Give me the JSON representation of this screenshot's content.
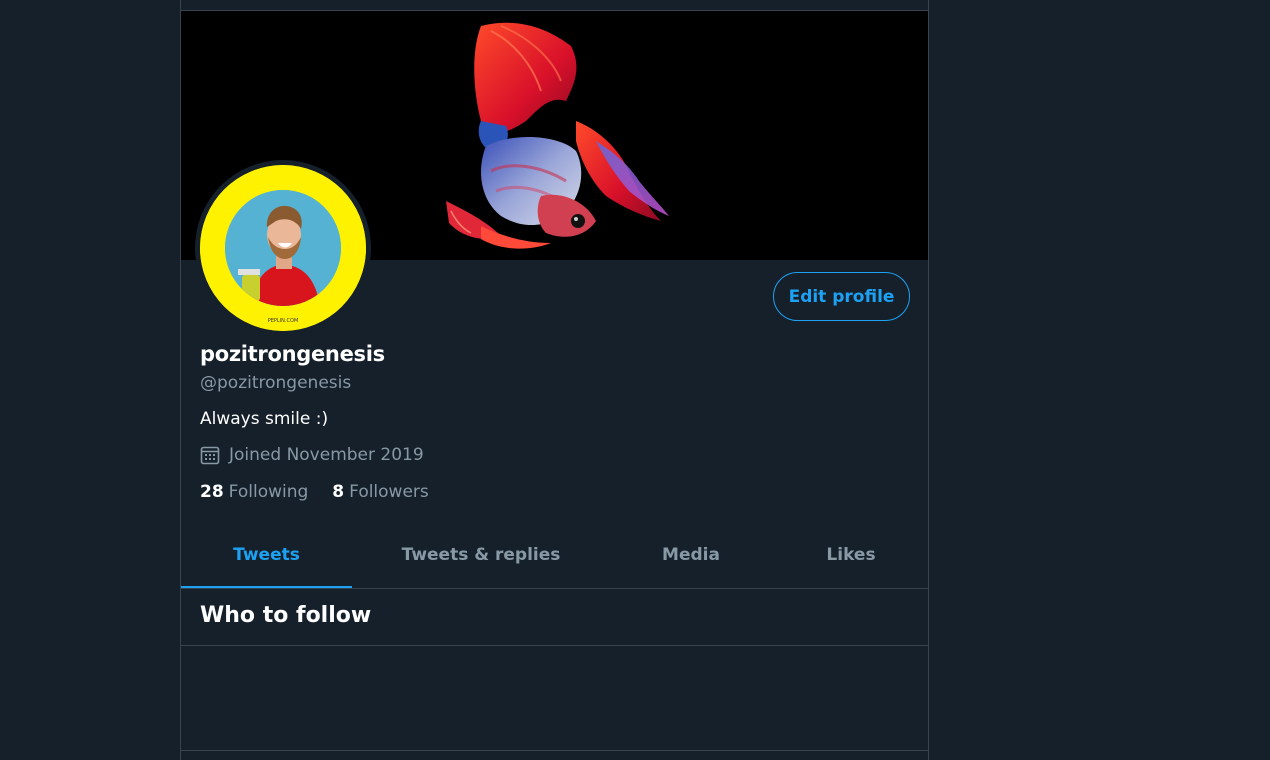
{
  "profile": {
    "display_name": "pozitrongenesis",
    "handle": "@pozitrongenesis",
    "bio": "Always smile :)",
    "joined": "Joined November 2019",
    "following_count": "28",
    "following_label": "Following",
    "followers_count": "8",
    "followers_label": "Followers",
    "edit_button_label": "Edit profile"
  },
  "tabs": [
    {
      "label": "Tweets",
      "active": true
    },
    {
      "label": "Tweets & replies",
      "active": false
    },
    {
      "label": "Media",
      "active": false
    },
    {
      "label": "Likes",
      "active": false
    }
  ],
  "who_to_follow": {
    "title": "Who to follow"
  },
  "colors": {
    "background": "#15202b",
    "accent": "#1da1f2",
    "secondary_text": "#8899a6",
    "border": "#38444d",
    "avatar_bg": "#fff200"
  }
}
